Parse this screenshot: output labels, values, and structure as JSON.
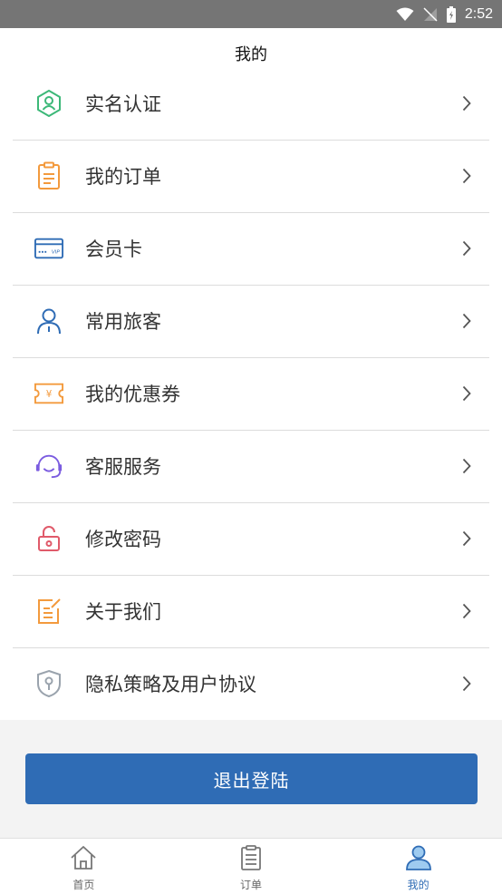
{
  "status_bar": {
    "time": "2:52"
  },
  "page_title": "我的",
  "menu": [
    {
      "label": "实名认证",
      "icon": "verified-user-icon"
    },
    {
      "label": "我的订单",
      "icon": "clipboard-icon"
    },
    {
      "label": "会员卡",
      "icon": "vip-card-icon"
    },
    {
      "label": "常用旅客",
      "icon": "person-icon"
    },
    {
      "label": "我的优惠券",
      "icon": "coupon-icon"
    },
    {
      "label": "客服服务",
      "icon": "headset-icon"
    },
    {
      "label": "修改密码",
      "icon": "lock-icon"
    },
    {
      "label": "关于我们",
      "icon": "edit-note-icon"
    },
    {
      "label": "隐私策略及用户协议",
      "icon": "shield-icon"
    }
  ],
  "logout_label": "退出登陆",
  "tabs": [
    {
      "label": "首页",
      "icon": "home-icon",
      "active": false
    },
    {
      "label": "订单",
      "icon": "order-icon",
      "active": false
    },
    {
      "label": "我的",
      "icon": "profile-icon",
      "active": true
    }
  ],
  "colors": {
    "accent": "#2f6cb5",
    "green": "#3cb878",
    "orange": "#f39a3d",
    "blue": "#2f6cb5",
    "purple": "#7b5ce0",
    "red": "#e05a6a",
    "gray": "#9aa3ad"
  }
}
